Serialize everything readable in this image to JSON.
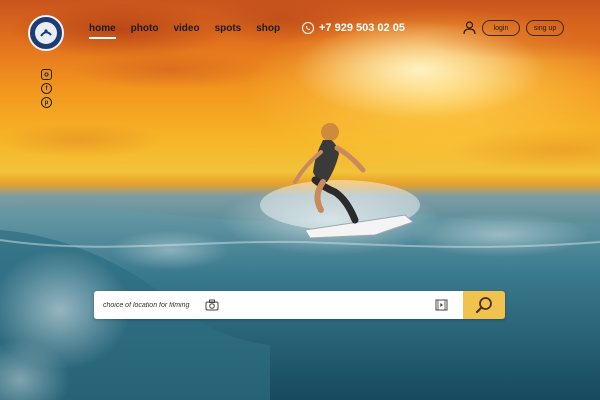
{
  "header": {
    "nav": [
      {
        "label": "home",
        "active": true
      },
      {
        "label": "photo",
        "active": false
      },
      {
        "label": "video",
        "active": false
      },
      {
        "label": "spots",
        "active": false
      },
      {
        "label": "shop",
        "active": false
      }
    ],
    "phone": "+7 929 503 02 05",
    "login_label": "login",
    "signup_label": "sing up"
  },
  "social": {
    "icons": [
      "instagram-icon",
      "facebook-icon",
      "pinterest-icon"
    ]
  },
  "search": {
    "placeholder": "choice of location for filming",
    "camera_icon": "camera-icon",
    "video_icon": "film-icon",
    "button_icon": "search-icon"
  },
  "colors": {
    "accent": "#f1c24d",
    "nav_text": "#1d1d1d",
    "phone_text": "#ffffff",
    "logo": "#1c3c76"
  }
}
